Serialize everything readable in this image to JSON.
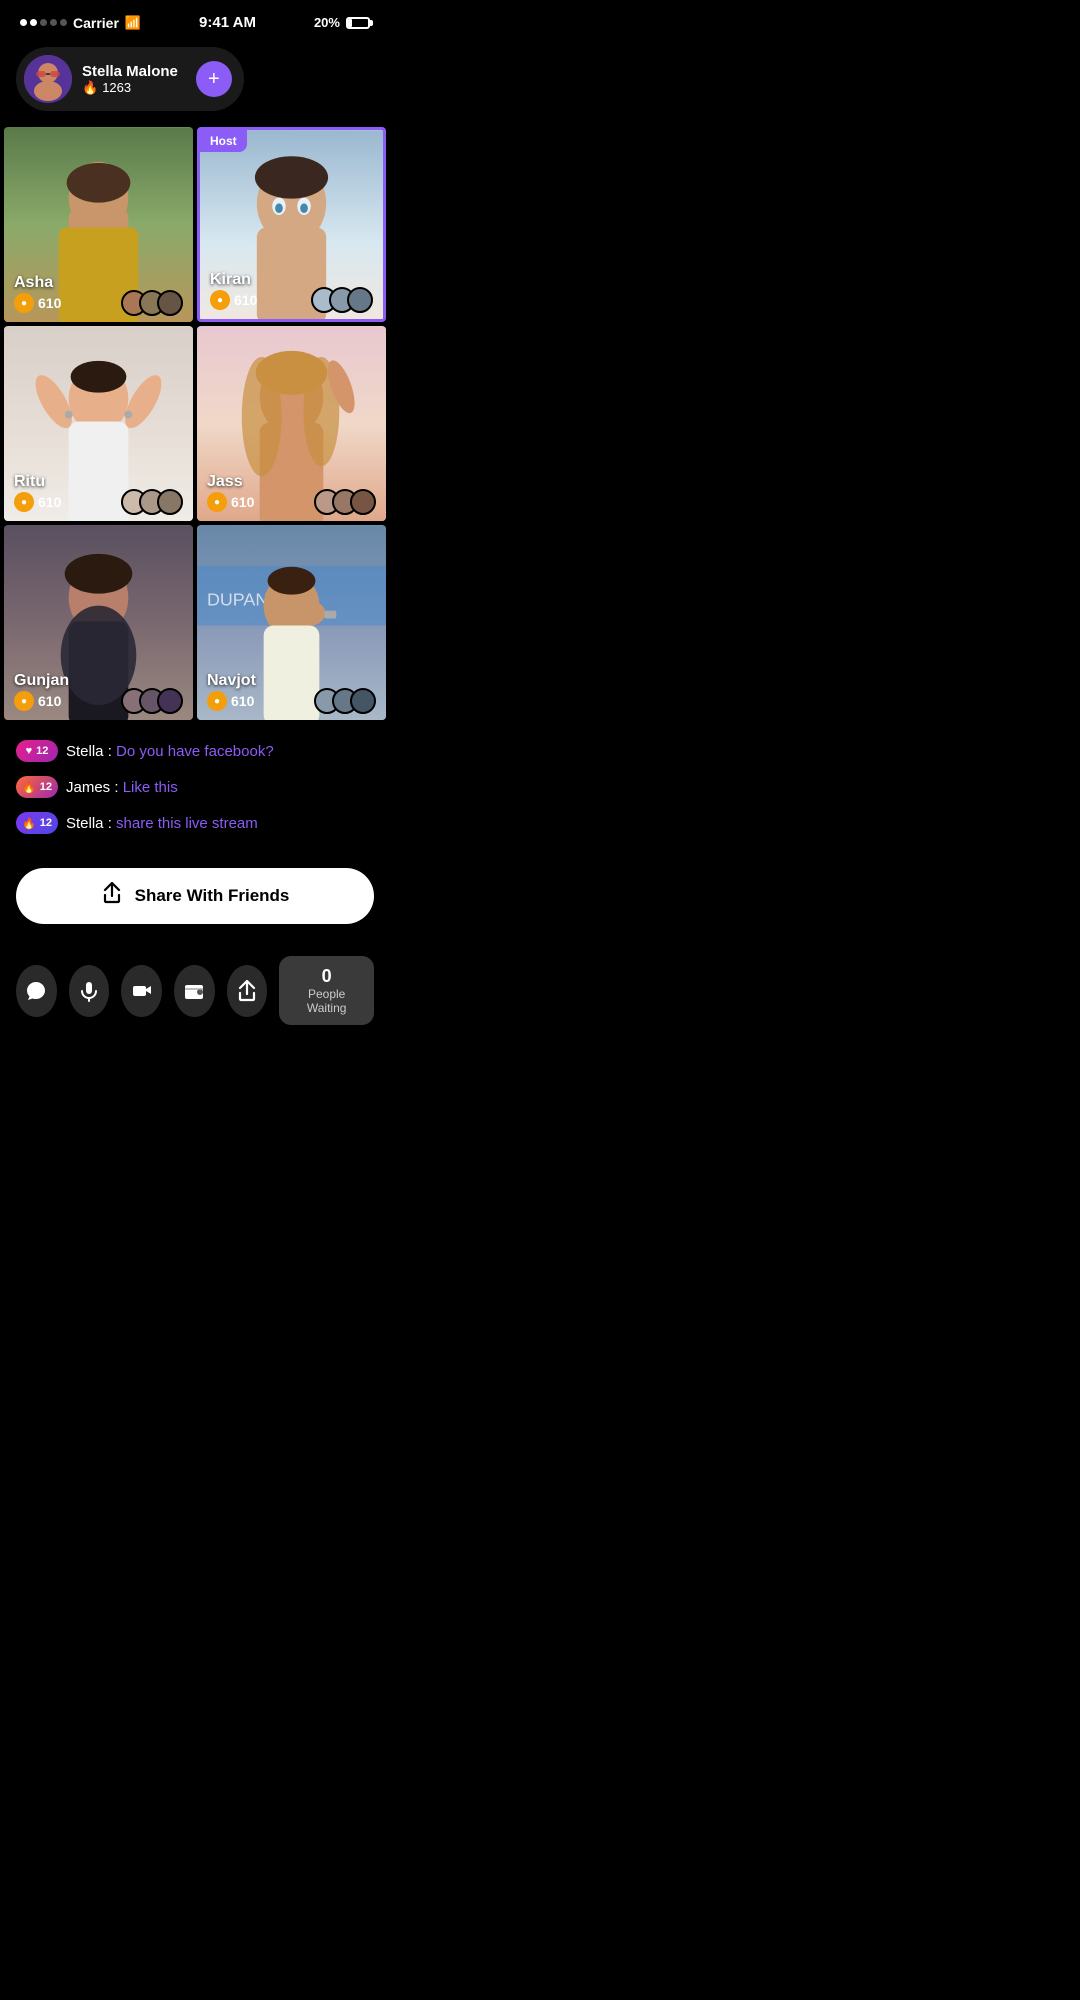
{
  "statusBar": {
    "carrier": "Carrier",
    "time": "9:41 AM",
    "battery": "20%",
    "signal": [
      true,
      true,
      false,
      false,
      false
    ]
  },
  "userCard": {
    "name": "Stella Malone",
    "score": "1263",
    "addLabel": "+"
  },
  "grid": {
    "cells": [
      {
        "id": "asha",
        "name": "Asha",
        "score": "610",
        "host": false,
        "photoClass": "photo-asha",
        "skinTone": "#c9956a"
      },
      {
        "id": "kiran",
        "name": "Kiran",
        "score": "610",
        "host": true,
        "photoClass": "photo-kiran",
        "skinTone": "#d4a882"
      },
      {
        "id": "ritu",
        "name": "Ritu",
        "score": "610",
        "host": false,
        "photoClass": "photo-ritu",
        "skinTone": "#e8b08a"
      },
      {
        "id": "jass",
        "name": "Jass",
        "score": "610",
        "host": false,
        "photoClass": "photo-jass",
        "skinTone": "#d4956a"
      },
      {
        "id": "gunjan",
        "name": "Gunjan",
        "score": "610",
        "host": false,
        "photoClass": "photo-gunjan",
        "skinTone": "#b8806a"
      },
      {
        "id": "navjot",
        "name": "Navjot",
        "score": "610",
        "host": false,
        "photoClass": "photo-navjot",
        "skinTone": "#c8956a"
      }
    ],
    "hostLabel": "Host"
  },
  "chat": {
    "messages": [
      {
        "badgeClass": "badge-pink",
        "badgeIcon": "♥",
        "badgeNum": "12",
        "sender": "Stella",
        "text": " : ",
        "highlight": "Do you have facebook?"
      },
      {
        "badgeClass": "badge-orange",
        "badgeIcon": "🔥",
        "badgeNum": "12",
        "sender": "James",
        "text": " : ",
        "highlight": "Like this"
      },
      {
        "badgeClass": "badge-purple",
        "badgeIcon": "🔥",
        "badgeNum": "12",
        "sender": "Stella",
        "text": " : ",
        "highlight": "share this live stream"
      }
    ]
  },
  "shareButton": {
    "label": "Share With Friends"
  },
  "bottomBar": {
    "actions": [
      {
        "id": "chat",
        "icon": "💬"
      },
      {
        "id": "mic",
        "icon": "🎙"
      },
      {
        "id": "video",
        "icon": "🎥"
      },
      {
        "id": "wallet",
        "icon": "👛"
      },
      {
        "id": "share",
        "icon": "📤"
      }
    ],
    "peopleWaiting": {
      "count": "0",
      "label": "People Waiting"
    }
  }
}
